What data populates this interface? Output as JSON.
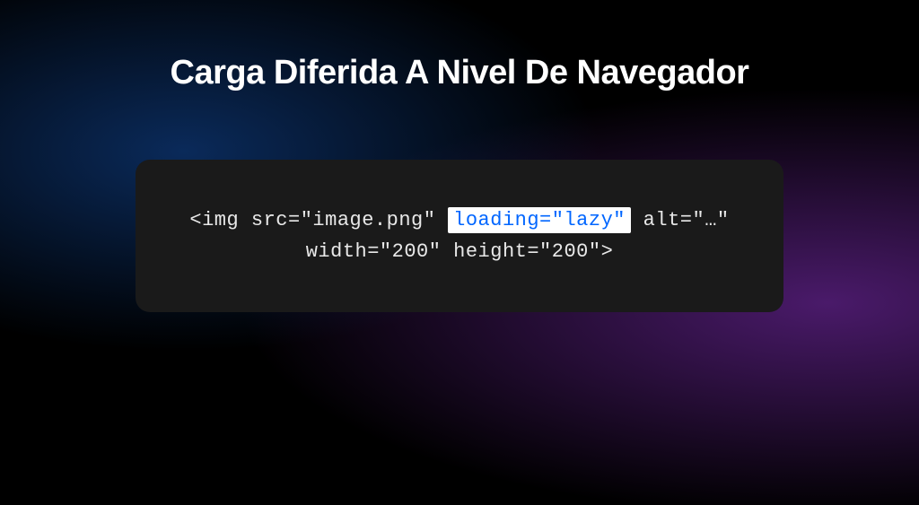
{
  "title": "Carga Diferida A Nivel De Navegador",
  "code": {
    "line1_part1": "<img src=\"image.png\" ",
    "line1_highlight": "loading=\"lazy\"",
    "line1_part2": " alt=\"…\"",
    "line2": "width=\"200\" height=\"200\">"
  }
}
